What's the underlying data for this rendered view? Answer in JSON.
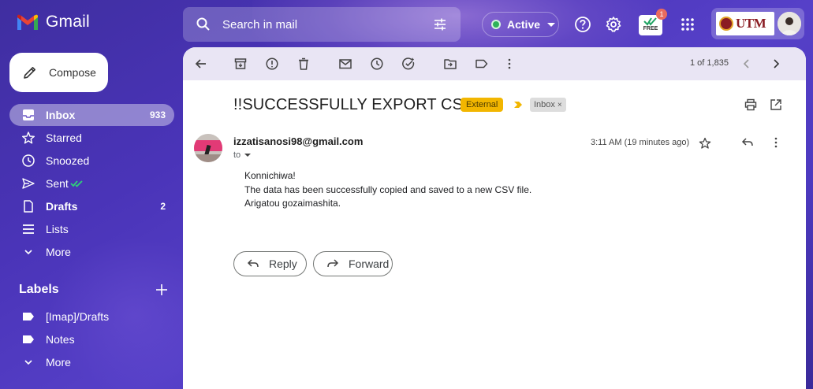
{
  "header": {
    "app_name": "Gmail",
    "search_placeholder": "Search in mail",
    "status_label": "Active",
    "badge_label": "FREE",
    "badge_count": "1",
    "org_logo_text": "UTM"
  },
  "colors": {
    "active_dot": "#2fb35a",
    "external_badge": "#f2b600",
    "selected_nav": "rgba(255,255,255,0.4)",
    "org_red": "#8a1c23"
  },
  "sidebar": {
    "compose_label": "Compose",
    "items": [
      {
        "label": "Inbox",
        "count": "933",
        "icon": "inbox-icon"
      },
      {
        "label": "Starred",
        "count": "",
        "icon": "star-icon"
      },
      {
        "label": "Snoozed",
        "count": "",
        "icon": "clock-icon"
      },
      {
        "label": "Sent",
        "count": "",
        "icon": "send-icon"
      },
      {
        "label": "Drafts",
        "count": "2",
        "icon": "draft-icon"
      },
      {
        "label": "Lists",
        "count": "",
        "icon": "list-icon"
      },
      {
        "label": "More",
        "count": "",
        "icon": "chevron-down-icon"
      }
    ],
    "labels_title": "Labels",
    "labels": [
      {
        "label": "[Imap]/Drafts",
        "icon": "label-icon"
      },
      {
        "label": "Notes",
        "icon": "label-icon"
      },
      {
        "label": "More",
        "icon": "chevron-down-icon"
      }
    ]
  },
  "toolbar": {
    "pager": "1 of 1,835"
  },
  "email": {
    "subject": "!!SUCCESSFULLY EXPORT CSV!!",
    "external_badge": "External",
    "inbox_badge": "Inbox",
    "inbox_badge_close": "×",
    "sender": "izzatisanosi98@gmail.com",
    "to": "to",
    "timestamp": "3:11 AM (19 minutes ago)",
    "body": [
      "Konnichiwa!",
      "The data has been successfully copied and saved to a new CSV file.",
      "Arigatou gozaimashita."
    ],
    "reply_label": "Reply",
    "forward_label": "Forward"
  }
}
